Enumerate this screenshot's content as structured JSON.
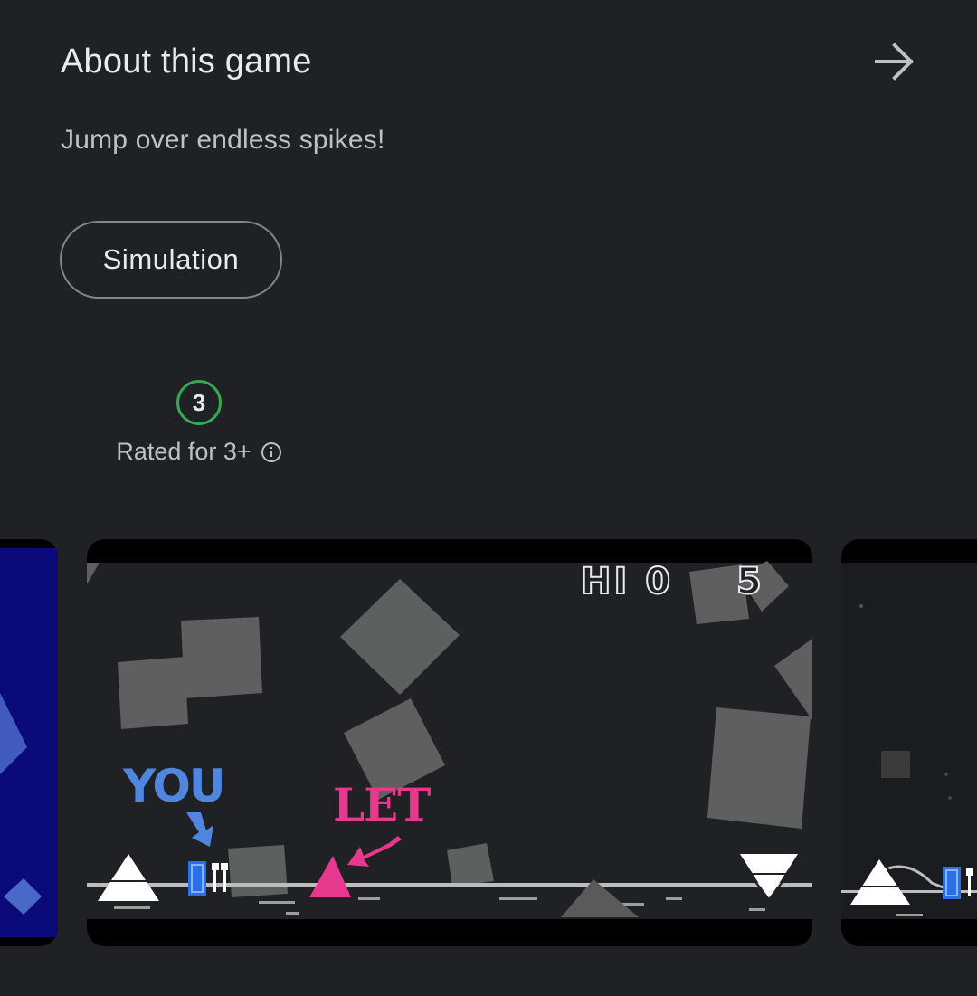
{
  "about": {
    "title": "About this game",
    "arrow_icon": "arrow-right-icon",
    "description": "Jump over endless spikes!"
  },
  "category_chip": {
    "label": "Simulation"
  },
  "content_rating": {
    "badge": "3",
    "label": "Rated for 3+",
    "info_icon": "info-icon",
    "badge_color": "#34a853"
  },
  "screenshots": {
    "main": {
      "hud_hi": "HI 0",
      "hud_score": "5",
      "label_you": "YOU",
      "label_let": "LET",
      "you_color": "#4f86e0",
      "let_color": "#e8388d"
    }
  },
  "colors": {
    "background": "#202124",
    "primary_text": "#e8eaed",
    "secondary_text": "#bdc1c6",
    "outline": "#80868b"
  }
}
